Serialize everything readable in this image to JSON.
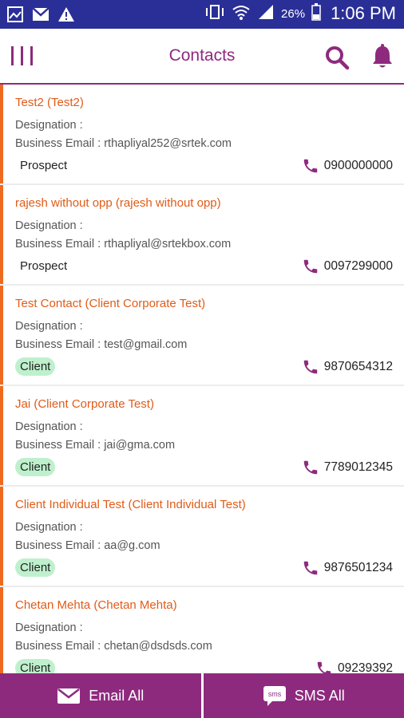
{
  "status_bar": {
    "battery": "26%",
    "time": "1:06 PM"
  },
  "header": {
    "title": "Contacts"
  },
  "contacts": [
    {
      "name": "Test2 (Test2)",
      "designation": "Designation :",
      "email": "Business Email : rthapliyal252@srtek.com",
      "tag": "Prospect",
      "phone": "0900000000"
    },
    {
      "name": "rajesh without opp (rajesh without opp)",
      "designation": "Designation :",
      "email": "Business Email : rthapliyal@srtekbox.com",
      "tag": "Prospect",
      "phone": "0097299000"
    },
    {
      "name": "Test Contact (Client Corporate Test)",
      "designation": "Designation :",
      "email": "Business Email : test@gmail.com",
      "tag": "Client",
      "phone": "9870654312"
    },
    {
      "name": "Jai (Client Corporate Test)",
      "designation": "Designation :",
      "email": "Business Email : jai@gma.com",
      "tag": "Client",
      "phone": "7789012345"
    },
    {
      "name": "Client Individual Test (Client Individual Test)",
      "designation": "Designation :",
      "email": "Business Email : aa@g.com",
      "tag": "Client",
      "phone": "9876501234"
    },
    {
      "name": "Chetan Mehta (Chetan Mehta)",
      "designation": "Designation :",
      "email": "Business Email : chetan@dsdsds.com",
      "tag": "Client",
      "phone": "09239392"
    }
  ],
  "footer": {
    "email_all": "Email All",
    "sms_all": "SMS All",
    "sms_icon_text": "sms"
  },
  "colors": {
    "status_bar": "#2a2f97",
    "brand": "#8e2a7e",
    "accent": "#ef6a1f",
    "client_badge": "#bff0cd"
  }
}
